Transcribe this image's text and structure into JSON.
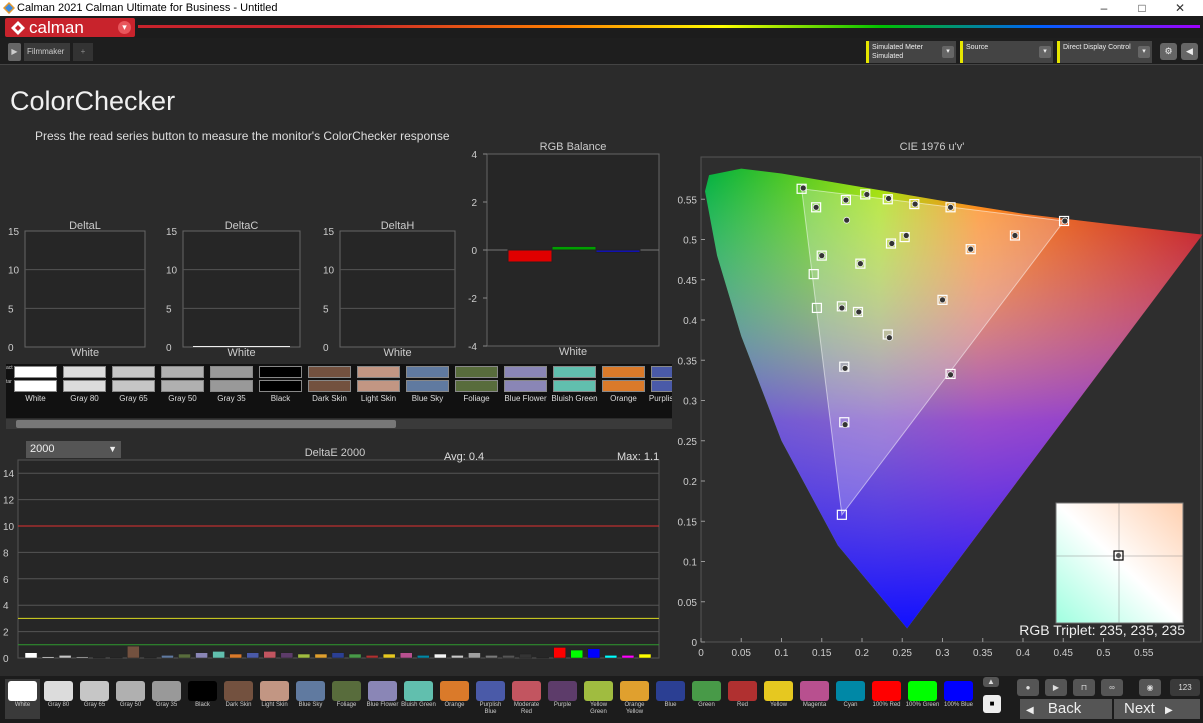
{
  "window": {
    "title": "Calman 2021 Calman Ultimate for Business - Untitled",
    "minimize": "–",
    "maximize": "□",
    "close": "✕"
  },
  "app": {
    "logo": "calman",
    "logo_icon": "calman-logo-icon"
  },
  "tabs": {
    "workflow": "Filmmaker",
    "add": "+"
  },
  "toolbar": {
    "meter": "Simulated Meter",
    "meter_sub": "Simulated",
    "source": "Source",
    "display": "Direct Display Control"
  },
  "page": {
    "title": "ColorChecker",
    "instructions": "Press the read series button to measure the monitor's ColorChecker response"
  },
  "colors": {
    "red_ref": "#e03030",
    "yellow_ref": "#d8d820",
    "green_ref": "#2e9a2e",
    "accent": "#c8232c",
    "combo_accent": "#e6e600"
  },
  "swatch_row": {
    "top_label": "act",
    "bottom_label": "tar",
    "items": [
      {
        "name": "White",
        "color": "#ffffff"
      },
      {
        "name": "Gray 80",
        "color": "#dcdcdc"
      },
      {
        "name": "Gray 65",
        "color": "#c6c6c6"
      },
      {
        "name": "Gray 50",
        "color": "#b0b0b0"
      },
      {
        "name": "Gray 35",
        "color": "#999999"
      },
      {
        "name": "Black",
        "color": "#000000"
      },
      {
        "name": "Dark Skin",
        "color": "#73513f"
      },
      {
        "name": "Light Skin",
        "color": "#c29683"
      },
      {
        "name": "Blue Sky",
        "color": "#607aa0"
      },
      {
        "name": "Foliage",
        "color": "#586c3c"
      },
      {
        "name": "Blue Flower",
        "color": "#8a86b6"
      },
      {
        "name": "Bluish Green",
        "color": "#61bfae"
      },
      {
        "name": "Orange",
        "color": "#da7a2a"
      },
      {
        "name": "Purplish Blue",
        "color": "#4a5aa8"
      }
    ]
  },
  "small_charts": [
    {
      "title": "DeltaL",
      "xlabel": "White",
      "ylim": [
        0,
        15
      ],
      "yticks": [
        "15",
        "10",
        "5",
        "0"
      ],
      "value": 0
    },
    {
      "title": "DeltaC",
      "xlabel": "White",
      "ylim": [
        0,
        15
      ],
      "yticks": [
        "15",
        "10",
        "5",
        "0"
      ],
      "value": 0.1
    },
    {
      "title": "DeltaH",
      "xlabel": "White",
      "ylim": [
        0,
        15
      ],
      "yticks": [
        "15",
        "10",
        "5",
        "0"
      ],
      "value": 0
    }
  ],
  "chart_data": [
    {
      "type": "bar",
      "title": "RGB Balance",
      "categories": [
        "White"
      ],
      "xlabel": "White",
      "ylim": [
        -4,
        4
      ],
      "yticks": [
        "4",
        "2",
        "0",
        "-2",
        "-4"
      ],
      "series": [
        {
          "color": "#e00000",
          "values": [
            -0.5
          ]
        },
        {
          "color": "#00a000",
          "values": [
            0.15
          ]
        },
        {
          "color": "#1010c0",
          "values": [
            -0.1
          ]
        }
      ]
    },
    {
      "type": "bar",
      "title": "DeltaE 2000",
      "avg_label": "Avg: 0.4",
      "max_label": "Max: 1.1",
      "selector": "2000",
      "ylim": [
        0,
        15
      ],
      "yticks": [
        "14",
        "12",
        "10",
        "8",
        "6",
        "4",
        "2",
        "0"
      ],
      "reference_lines": [
        10,
        3,
        1
      ],
      "values": [
        0.4,
        0.1,
        0.2,
        0.1,
        0,
        0,
        0.9,
        0,
        0.2,
        0.3,
        0.4,
        0.5,
        0.3,
        0.4,
        0.5,
        0.4,
        0.3,
        0.3,
        0.4,
        0.3,
        0.2,
        0.3,
        0.4,
        0.2,
        0.3,
        0.2,
        0.4,
        0.2,
        0.2,
        0.3,
        0,
        0.8,
        0.6,
        0.7,
        0.2,
        0.2,
        0.3
      ],
      "bar_colors": [
        "#ffffff",
        "#dcdcdc",
        "#c6c6c6",
        "#b0b0b0",
        "#999999",
        "#000000",
        "#73513f",
        "#c29683",
        "#607aa0",
        "#586c3c",
        "#8a86b6",
        "#61bfae",
        "#da7a2a",
        "#4a5aa8",
        "#c25560",
        "#5d3c6a",
        "#a0bc40",
        "#e0a02e",
        "#2b3f93",
        "#489a48",
        "#b03030",
        "#e6c820",
        "#b8508f",
        "#0088a6",
        "#f5f5f5",
        "#c8c8c8",
        "#a0a0a0",
        "#7a7a7a",
        "#555555",
        "#343434",
        "#000000",
        "#ff0000",
        "#00ff00",
        "#0000ff",
        "#00ffff",
        "#ff00ff",
        "#ffff00"
      ]
    },
    {
      "type": "scatter",
      "title": "CIE 1976 u'v'",
      "xlim": [
        0,
        0.6
      ],
      "ylim": [
        0,
        0.6
      ],
      "xticks": [
        "0",
        "0.05",
        "0.1",
        "0.15",
        "0.2",
        "0.25",
        "0.3",
        "0.35",
        "0.4",
        "0.45",
        "0.5",
        "0.55"
      ],
      "yticks": [
        "0",
        "0.05",
        "0.1",
        "0.15",
        "0.2",
        "0.25",
        "0.3",
        "0.35",
        "0.4",
        "0.45",
        "0.5",
        "0.55"
      ],
      "gamut": [
        [
          0.451,
          0.523
        ],
        [
          0.125,
          0.563
        ],
        [
          0.175,
          0.158
        ]
      ],
      "targets": [
        [
          0.125,
          0.563
        ],
        [
          0.143,
          0.54
        ],
        [
          0.18,
          0.549
        ],
        [
          0.204,
          0.556
        ],
        [
          0.232,
          0.55
        ],
        [
          0.265,
          0.544
        ],
        [
          0.31,
          0.54
        ],
        [
          0.451,
          0.523
        ],
        [
          0.39,
          0.505
        ],
        [
          0.335,
          0.488
        ],
        [
          0.253,
          0.503
        ],
        [
          0.236,
          0.495
        ],
        [
          0.15,
          0.48
        ],
        [
          0.14,
          0.457
        ],
        [
          0.198,
          0.47
        ],
        [
          0.144,
          0.415
        ],
        [
          0.175,
          0.417
        ],
        [
          0.195,
          0.41
        ],
        [
          0.232,
          0.382
        ],
        [
          0.3,
          0.425
        ],
        [
          0.178,
          0.342
        ],
        [
          0.31,
          0.333
        ],
        [
          0.178,
          0.273
        ],
        [
          0.175,
          0.158
        ]
      ],
      "measured": [
        [
          0.127,
          0.564
        ],
        [
          0.143,
          0.54
        ],
        [
          0.18,
          0.549
        ],
        [
          0.206,
          0.556
        ],
        [
          0.233,
          0.551
        ],
        [
          0.266,
          0.544
        ],
        [
          0.31,
          0.54
        ],
        [
          0.452,
          0.523
        ],
        [
          0.39,
          0.505
        ],
        [
          0.335,
          0.488
        ],
        [
          0.255,
          0.505
        ],
        [
          0.237,
          0.495
        ],
        [
          0.181,
          0.524
        ],
        [
          0.15,
          0.48
        ],
        [
          0.198,
          0.47
        ],
        [
          0.175,
          0.415
        ],
        [
          0.196,
          0.41
        ],
        [
          0.234,
          0.378
        ],
        [
          0.3,
          0.425
        ],
        [
          0.179,
          0.34
        ],
        [
          0.31,
          0.332
        ],
        [
          0.179,
          0.27
        ]
      ],
      "inset_label": "RGB Triplet: 235, 235, 235"
    }
  ],
  "bottom_swatches": [
    {
      "label": "White",
      "color": "#ffffff"
    },
    {
      "label": "Gray 80",
      "color": "#dcdcdc"
    },
    {
      "label": "Gray 65",
      "color": "#c6c6c6"
    },
    {
      "label": "Gray 50",
      "color": "#b0b0b0"
    },
    {
      "label": "Gray 35",
      "color": "#999999"
    },
    {
      "label": "Black",
      "color": "#000000"
    },
    {
      "label": "Dark Skin",
      "color": "#73513f"
    },
    {
      "label": "Light Skin",
      "color": "#c29683"
    },
    {
      "label": "Blue Sky",
      "color": "#607aa0"
    },
    {
      "label": "Foliage",
      "color": "#586c3c"
    },
    {
      "label": "Blue Flower",
      "color": "#8a86b6"
    },
    {
      "label": "Bluish Green",
      "color": "#61bfae"
    },
    {
      "label": "Orange",
      "color": "#da7a2a"
    },
    {
      "label": "Purplish Blue",
      "color": "#4a5aa8"
    },
    {
      "label": "Moderate Red",
      "color": "#c25560"
    },
    {
      "label": "Purple",
      "color": "#5d3c6a"
    },
    {
      "label": "Yellow Green",
      "color": "#a0bc40"
    },
    {
      "label": "Orange Yellow",
      "color": "#e0a02e"
    },
    {
      "label": "Blue",
      "color": "#2b3f93"
    },
    {
      "label": "Green",
      "color": "#489a48"
    },
    {
      "label": "Red",
      "color": "#b03030"
    },
    {
      "label": "Yellow",
      "color": "#e6c820"
    },
    {
      "label": "Magenta",
      "color": "#b8508f"
    },
    {
      "label": "Cyan",
      "color": "#0088a6"
    },
    {
      "label": "100% Red",
      "color": "#ff0000"
    },
    {
      "label": "100% Green",
      "color": "#00ff00"
    },
    {
      "label": "100% Blue",
      "color": "#0000ff"
    }
  ],
  "nav": {
    "back": "Back",
    "next": "Next",
    "counter": "123"
  }
}
